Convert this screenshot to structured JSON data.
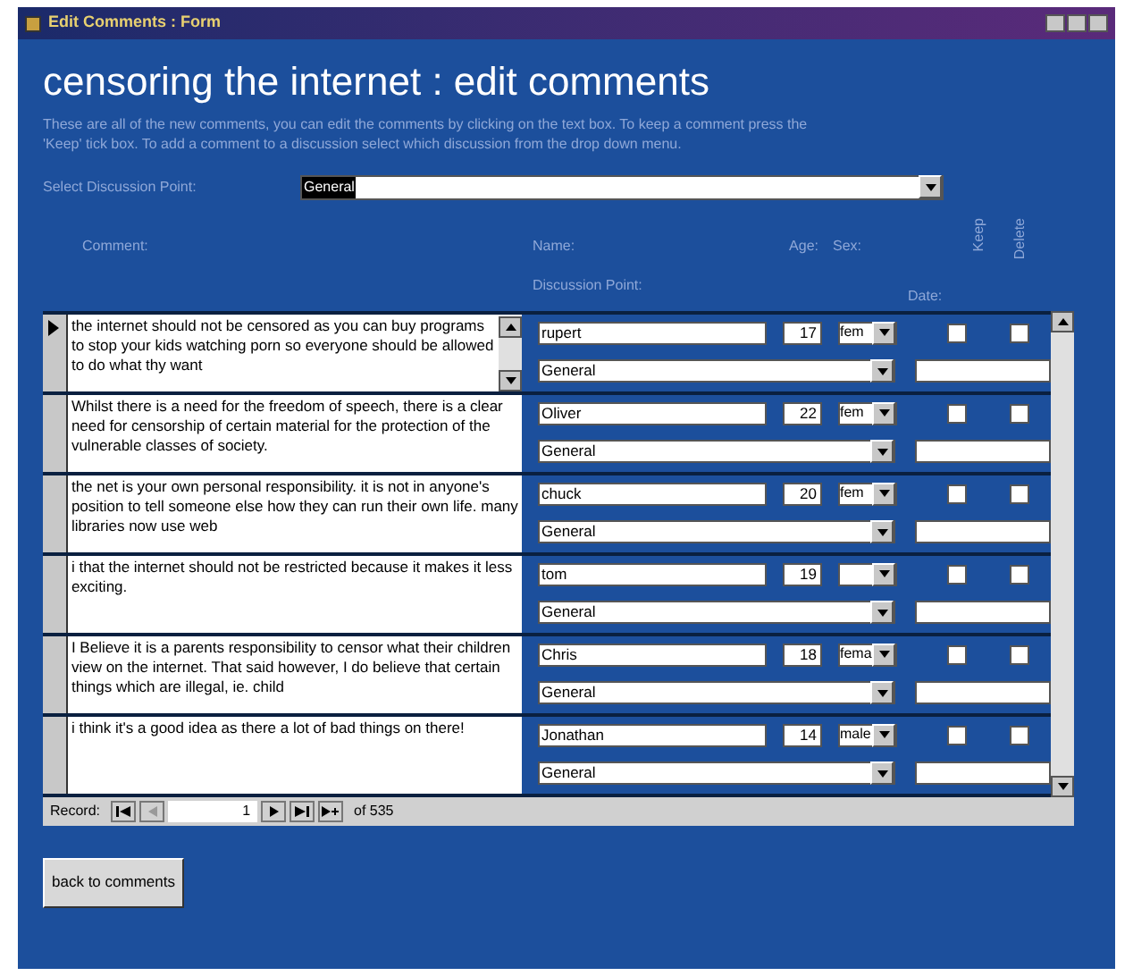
{
  "window": {
    "title": "Edit Comments : Form"
  },
  "heading": "censoring the internet : edit comments",
  "intro": "These are all of the new comments, you can edit the comments by clicking on the text box. To keep a comment press the 'Keep' tick box. To add a comment to a discussion select which discussion from the drop down menu.",
  "discussion_select": {
    "label": "Select Discussion Point:",
    "value": "General"
  },
  "columns": {
    "comment": "Comment:",
    "name": "Name:",
    "age": "Age:",
    "sex": "Sex:",
    "keep": "Keep",
    "delete": "Delete",
    "discussion": "Discussion Point:",
    "date": "Date:"
  },
  "records": [
    {
      "selected": true,
      "comment": "the internet should not be censored as you can buy programs to stop your kids watching porn so everyone should be allowed to do what thy want",
      "name": "rupert",
      "age": "17",
      "sex": "fem",
      "discussion": "General",
      "keep": false,
      "delete": false
    },
    {
      "selected": false,
      "comment": "Whilst there is a need for the freedom of speech, there is a clear need for censorship of certain material for the protection of the vulnerable classes of society.",
      "name": "Oliver",
      "age": "22",
      "sex": "fem",
      "discussion": "General",
      "keep": false,
      "delete": false
    },
    {
      "selected": false,
      "comment": "the net is your own personal responsibility.  it is not in anyone's position to tell someone else how they can run their own life.  many libraries now use web",
      "name": "chuck",
      "age": "20",
      "sex": "fem",
      "discussion": "General",
      "keep": false,
      "delete": false
    },
    {
      "selected": false,
      "comment": "i that the internet should not be restricted because it makes it less exciting.",
      "name": "tom",
      "age": "19",
      "discussion": "General",
      "keep": false,
      "delete": false
    },
    {
      "selected": false,
      "comment": "I Believe it is a parents responsibility to censor what their children view on the internet. That said however, I do believe that certain things which are illegal, ie. child",
      "name": "Chris",
      "age": "18",
      "sex": "fema",
      "discussion": "General",
      "keep": false,
      "delete": false
    },
    {
      "selected": false,
      "comment": "i think it's a good idea as there a lot of bad things on there!",
      "name": "Jonathan",
      "age": "14",
      "sex": "male",
      "discussion": "General",
      "keep": false,
      "delete": false
    }
  ],
  "navigation": {
    "label": "Record:",
    "current": "1",
    "total": "of 535"
  },
  "buttons": [
    "back to comments"
  ]
}
